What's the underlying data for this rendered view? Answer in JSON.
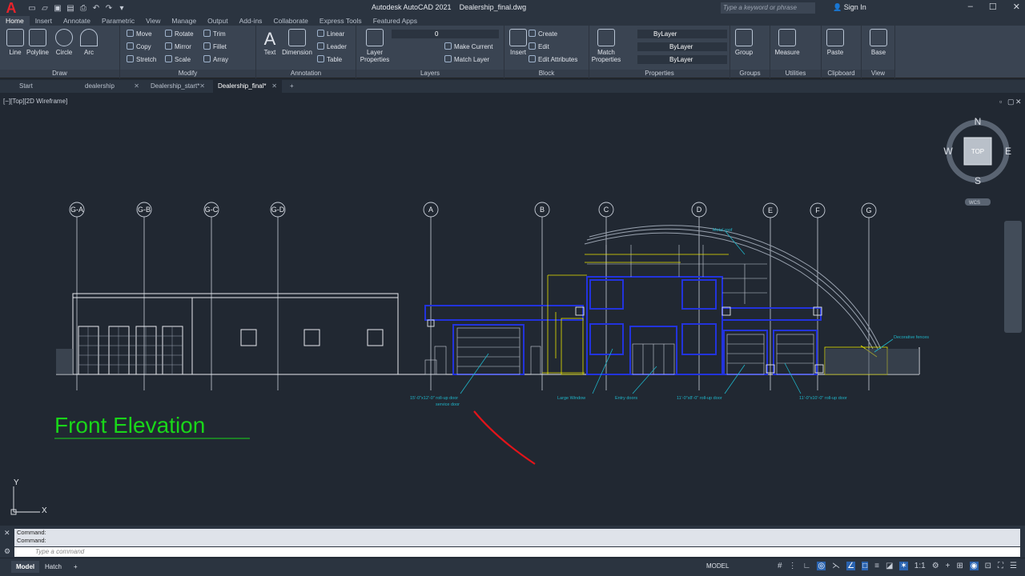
{
  "app": {
    "window_title": "Autodesk AutoCAD 2021",
    "file_name": "Dealership_final.dwg",
    "search_placeholder": "Type a keyword or phrase",
    "sign_in": "Sign In"
  },
  "ribbon_tabs": [
    "Home",
    "Insert",
    "Annotate",
    "Parametric",
    "View",
    "Manage",
    "Output",
    "Add-ins",
    "Collaborate",
    "Express Tools",
    "Featured Apps"
  ],
  "panels": {
    "draw": {
      "title": "Draw",
      "tools": [
        "Line",
        "Polyline",
        "Circle",
        "Arc"
      ]
    },
    "modify": {
      "title": "Modify",
      "tools": [
        "Move",
        "Rotate",
        "Trim",
        "Copy",
        "Mirror",
        "Fillet",
        "Stretch",
        "Scale",
        "Array"
      ]
    },
    "annotation": {
      "title": "Annotation",
      "big": [
        "Text",
        "Dimension"
      ],
      "tools": [
        "Linear",
        "Leader",
        "Table"
      ]
    },
    "layers": {
      "title": "Layers",
      "big": "Layer Properties",
      "layer_value": "0",
      "tools": [
        "Make Current",
        "Match Layer"
      ]
    },
    "block": {
      "title": "Block",
      "big": "Insert",
      "tools": [
        "Create",
        "Edit",
        "Edit Attributes"
      ]
    },
    "properties": {
      "title": "Properties",
      "big": "Match Properties",
      "values": [
        "ByLayer",
        "ByLayer",
        "ByLayer"
      ]
    },
    "groups": {
      "title": "Groups",
      "big": "Group"
    },
    "utilities": {
      "title": "Utilities",
      "big": "Measure"
    },
    "clipboard": {
      "title": "Clipboard",
      "big": "Paste"
    },
    "view": {
      "title": "View",
      "big": "Base"
    }
  },
  "doc_tabs": [
    {
      "label": "Start"
    },
    {
      "label": "dealership"
    },
    {
      "label": "Dealership_start*"
    },
    {
      "label": "Dealership_final*"
    }
  ],
  "viewport_label": "[−][Top][2D Wireframe]",
  "viewcube": {
    "n": "N",
    "s": "S",
    "e": "E",
    "w": "W",
    "face": "TOP",
    "wcs": "WCS"
  },
  "drawing": {
    "title": "Front Elevation",
    "grid_labels": [
      "G-A",
      "G-B",
      "G-C",
      "G-D",
      "A",
      "B",
      "C",
      "D",
      "E",
      "F",
      "G"
    ],
    "annotations": [
      "Metal roof",
      "Decorative fences",
      "15'-0\"x12'-0\" roll-up door",
      "service door",
      "Large Window",
      "Entry doors",
      "11'-0\"x8'-0\" roll-up door",
      "11'-0\"x10'-0\" roll-up door"
    ],
    "ucs": {
      "x": "X",
      "y": "Y"
    }
  },
  "command": {
    "history": [
      "Command:",
      "Command:"
    ],
    "placeholder": "Type a command"
  },
  "status": {
    "tabs": [
      "Model",
      "Hatch"
    ],
    "model_label": "MODEL",
    "scale": "1:1"
  }
}
